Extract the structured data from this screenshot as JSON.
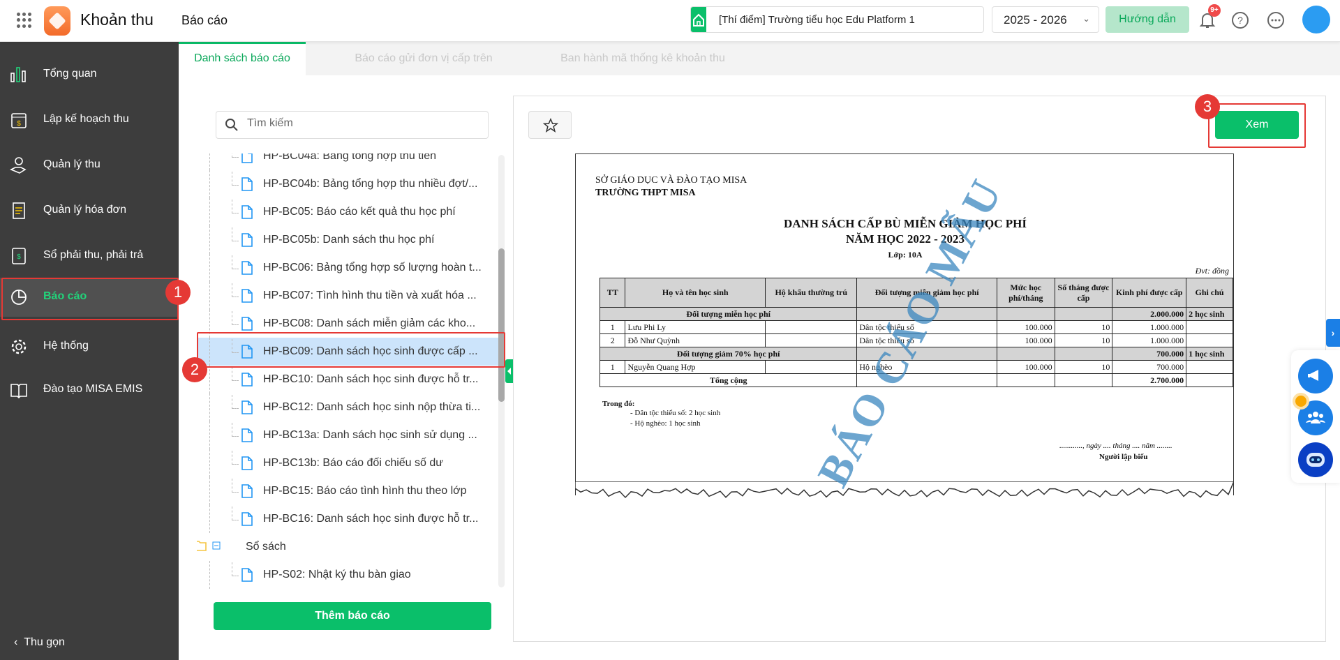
{
  "header": {
    "app_name": "Khoản thu",
    "page_title": "Báo cáo",
    "school": "[Thí điểm] Trường tiểu học Edu Platform 1",
    "year": "2025 - 2026",
    "guide_label": "Hướng dẫn",
    "notification_badge": "9+"
  },
  "sidebar": {
    "items": [
      {
        "label": "Tổng quan",
        "icon": "bar-chart-icon"
      },
      {
        "label": "Lập kế hoạch thu",
        "icon": "calendar-icon"
      },
      {
        "label": "Quản lý thu",
        "icon": "money-hand-icon"
      },
      {
        "label": "Quản lý hóa đơn",
        "icon": "invoice-icon"
      },
      {
        "label": "Sổ phải thu, phải trả",
        "icon": "ledger-icon"
      },
      {
        "label": "Báo cáo",
        "icon": "pie-chart-icon",
        "active": true
      },
      {
        "label": "Hệ thống",
        "icon": "gear-icon"
      },
      {
        "label": "Đào tạo MISA EMIS",
        "icon": "book-icon"
      }
    ],
    "collapse_label": "Thu gọn"
  },
  "tabs": [
    {
      "label": "Danh sách báo cáo",
      "active": true
    },
    {
      "label": "Báo cáo gửi đơn vị cấp trên"
    },
    {
      "label": "Ban hành mã thống kê khoản thu"
    }
  ],
  "search": {
    "placeholder": "Tìm kiếm"
  },
  "tree": [
    {
      "label": "HP-BC04a: Bảng tổng hợp thu tiền"
    },
    {
      "label": "HP-BC04b: Bảng tổng hợp thu nhiều đợt/..."
    },
    {
      "label": "HP-BC05: Báo cáo kết quả thu học phí"
    },
    {
      "label": "HP-BC05b: Danh sách thu học phí"
    },
    {
      "label": "HP-BC06: Bảng tổng hợp số lượng hoàn t..."
    },
    {
      "label": "HP-BC07: Tình hình thu tiền và xuất hóa ..."
    },
    {
      "label": "HP-BC08: Danh sách miễn giảm các kho..."
    },
    {
      "label": "HP-BC09: Danh sách học sinh được cấp ...",
      "selected": true
    },
    {
      "label": "HP-BC10: Danh sách học sinh được hỗ tr..."
    },
    {
      "label": "HP-BC12: Danh sách học sinh nộp thừa ti..."
    },
    {
      "label": "HP-BC13a: Danh sách học sinh sử dụng ..."
    },
    {
      "label": "HP-BC13b: Báo cáo đối chiếu số dư"
    },
    {
      "label": "HP-BC15: Báo cáo tình hình thu theo lớp"
    },
    {
      "label": "HP-BC16: Danh sách học sinh được hỗ tr..."
    }
  ],
  "folder": {
    "label": "Sổ sách",
    "children": [
      {
        "label": "HP-S02: Nhật ký thu bàn giao"
      }
    ]
  },
  "add_report_label": "Thêm báo cáo",
  "view_label": "Xem",
  "steps": [
    "1",
    "2",
    "3"
  ],
  "report": {
    "org": "SỞ GIÁO DỤC VÀ ĐÀO TẠO MISA",
    "school": "TRƯỜNG THPT MISA",
    "title": "DANH SÁCH CẤP BÙ MIỄN GIẢM HỌC PHÍ",
    "subtitle": "NĂM HỌC 2022 - 2023",
    "class": "Lớp: 10A",
    "unit": "Đvt: đồng",
    "columns": [
      "TT",
      "Họ và tên học sinh",
      "Hộ khẩu thường trú",
      "Đối tượng miễn giảm học phí",
      "Mức học phí/tháng",
      "Số tháng được cấp",
      "Kinh phí được cấp",
      "Ghi chú"
    ],
    "groups": [
      {
        "name": "Đối tượng miễn học phí",
        "total": "2.000.000",
        "note": "2 học sinh",
        "rows": [
          [
            "1",
            "Lưu Phi Ly",
            "",
            "Dân tộc thiểu số",
            "100.000",
            "10",
            "1.000.000",
            ""
          ],
          [
            "2",
            "Đỗ Như Quỳnh",
            "",
            "Dân tộc thiểu số",
            "100.000",
            "10",
            "1.000.000",
            ""
          ]
        ]
      },
      {
        "name": "Đối tượng giảm 70% học phí",
        "total": "700.000",
        "note": "1 học sinh",
        "rows": [
          [
            "1",
            "Nguyễn Quang Hợp",
            "",
            "Hộ nghèo",
            "100.000",
            "10",
            "700.000",
            ""
          ]
        ]
      }
    ],
    "grand_total_label": "Tổng cộng",
    "grand_total": "2.700.000",
    "notes_title": "Trong đó:",
    "notes": [
      "- Dân tộc thiểu số: 2 học sinh",
      "- Hộ nghèo: 1 học sinh"
    ],
    "date_line": "............, ngày .... tháng .... năm ........",
    "signer": "Người lập biểu",
    "watermark": "BÁO CÁO MẪU"
  },
  "colors": {
    "accent": "#0abf6a",
    "sidebar_bg": "#3d3d3d",
    "highlight": "#e53935",
    "selected_row": "#cce4fb"
  }
}
